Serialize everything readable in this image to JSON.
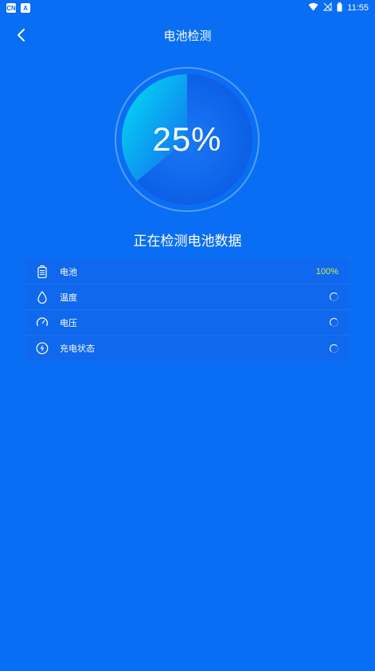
{
  "statusbar": {
    "time": "11:55",
    "left_icons": [
      "cn-app-icon",
      "a-app-icon"
    ],
    "left_icon_labels": [
      "CN",
      "A"
    ],
    "right_icons": [
      "wifi-icon",
      "no-signal-icon",
      "battery-icon"
    ]
  },
  "header": {
    "title": "电池检测"
  },
  "gauge": {
    "value_text": "25%",
    "progress": 0.25,
    "colors": {
      "fill_start": "#00e0f0",
      "fill_end": "#1a7ff0",
      "ring": "#8fc4ff"
    }
  },
  "scan_status": "正在检测电池数据",
  "items": [
    {
      "label": "电池",
      "icon": "battery-icon",
      "value": "100%",
      "state": "done"
    },
    {
      "label": "温度",
      "icon": "water-drop-icon",
      "value": "",
      "state": "loading"
    },
    {
      "label": "电压",
      "icon": "gauge-icon",
      "value": "",
      "state": "loading"
    },
    {
      "label": "充电状态",
      "icon": "charging-icon",
      "value": "",
      "state": "loading"
    }
  ],
  "colors": {
    "background": "#0a6ef5",
    "accent_value": "#c8f04a"
  }
}
